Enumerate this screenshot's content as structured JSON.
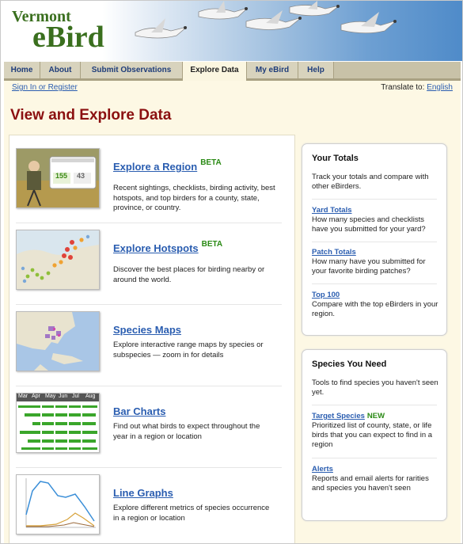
{
  "header": {
    "logo_small": "Vermont",
    "logo_big": "eBird"
  },
  "nav": [
    {
      "label": "Home"
    },
    {
      "label": "About"
    },
    {
      "label": "Submit Observations"
    },
    {
      "label": "Explore Data",
      "active": true
    },
    {
      "label": "My eBird"
    },
    {
      "label": "Help"
    }
  ],
  "subbar": {
    "signin": "Sign In or Register",
    "translate_label": "Translate to:",
    "translate_lang": "English"
  },
  "page_title": "View and Explore Data",
  "items": [
    {
      "title": "Explore a Region",
      "badge": "BETA",
      "desc": "Recent sightings, checklists, birding activity, best hotspots, and top birders for a county, state, province, or country.",
      "thumb": "region-thumbnail",
      "thumb_num1": "155",
      "thumb_num2": "43"
    },
    {
      "title": "Explore Hotspots",
      "badge": "BETA",
      "desc": "Discover the best places for birding nearby or around the world.",
      "thumb": "hotspots-map-thumbnail"
    },
    {
      "title": "Species Maps",
      "badge": "",
      "desc": "Explore interactive range maps by species or subspecies — zoom in for details",
      "thumb": "species-map-thumbnail"
    },
    {
      "title": "Bar Charts",
      "badge": "",
      "desc": "Find out what birds to expect throughout the year in a region or location",
      "thumb": "bar-chart-thumbnail",
      "months": [
        "Mar",
        "Apr",
        "May",
        "Jun",
        "Jul",
        "Aug"
      ]
    },
    {
      "title": "Line Graphs",
      "badge": "",
      "desc": "Explore different metrics of species occurrence in a region or location",
      "thumb": "line-graph-thumbnail"
    }
  ],
  "your_totals": {
    "heading": "Your Totals",
    "intro": "Track your totals and compare with other eBirders.",
    "links": [
      {
        "label": "Yard Totals",
        "desc": "How many species and checklists have you submitted for your yard?"
      },
      {
        "label": "Patch Totals",
        "desc": "How many have you submitted for your favorite birding patches?"
      },
      {
        "label": "Top 100",
        "desc": "Compare with the top eBirders in your region."
      }
    ]
  },
  "species_you_need": {
    "heading": "Species You Need",
    "intro": "Tools to find species you haven't seen yet.",
    "links": [
      {
        "label": "Target Species",
        "badge": "NEW",
        "desc": "Prioritized list of county, state, or life birds that you can expect to find in a region"
      },
      {
        "label": "Alerts",
        "badge": "",
        "desc": "Reports and email alerts for rarities and species you haven't seen"
      }
    ]
  },
  "colors": {
    "title_red": "#8b1010",
    "link_blue": "#2a5db0",
    "badge_green": "#2a8a14",
    "logo_green": "#3a6f1e",
    "cream": "#fdf8e4"
  }
}
